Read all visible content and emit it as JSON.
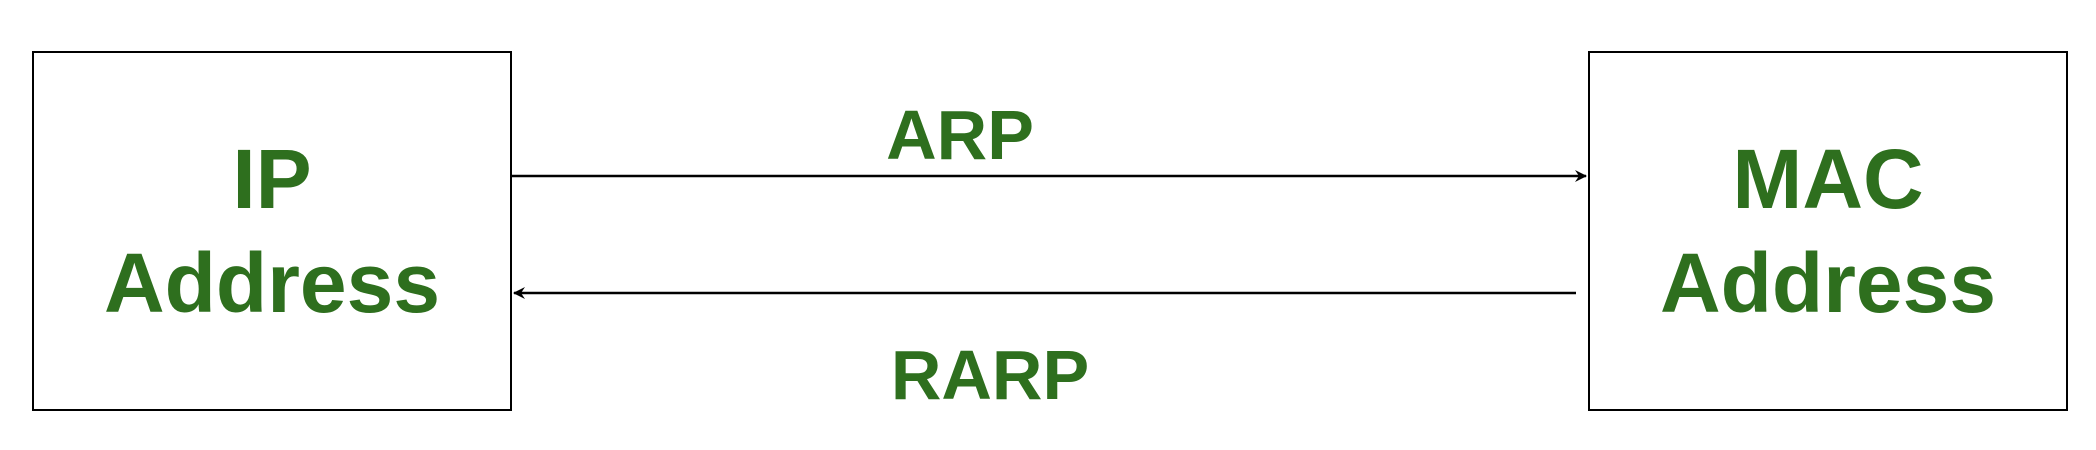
{
  "nodes": {
    "ip": {
      "line1": "IP",
      "line2": "Address"
    },
    "mac": {
      "line1": "MAC",
      "line2": "Address"
    }
  },
  "edges": {
    "arp": {
      "label": "ARP",
      "from": "ip",
      "to": "mac"
    },
    "rarp": {
      "label": "RARP",
      "from": "mac",
      "to": "ip"
    }
  },
  "colors": {
    "label": "#2e6f1e",
    "line": "#000000",
    "box_border": "#000000"
  }
}
